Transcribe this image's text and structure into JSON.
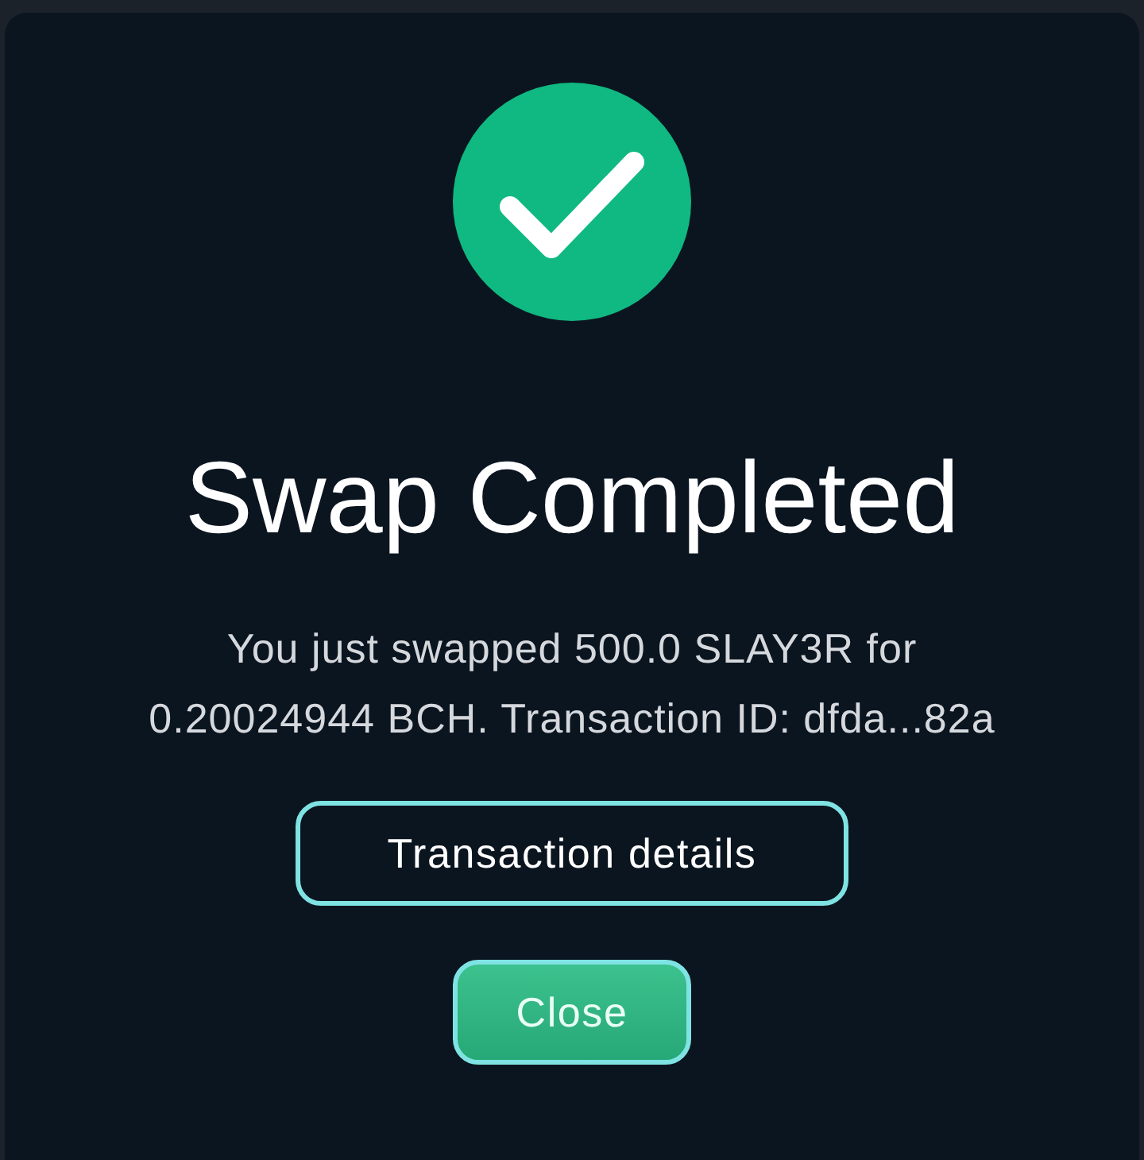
{
  "status": {
    "kind": "success"
  },
  "title": "Swap Completed",
  "message": "You just swapped 500.0 SLAY3R for 0.20024944 BCH. Transaction ID: dfda...82a",
  "buttons": [
    {
      "label": "Transaction details",
      "kind": "secondary"
    },
    {
      "label": "Close",
      "kind": "primary"
    }
  ]
}
